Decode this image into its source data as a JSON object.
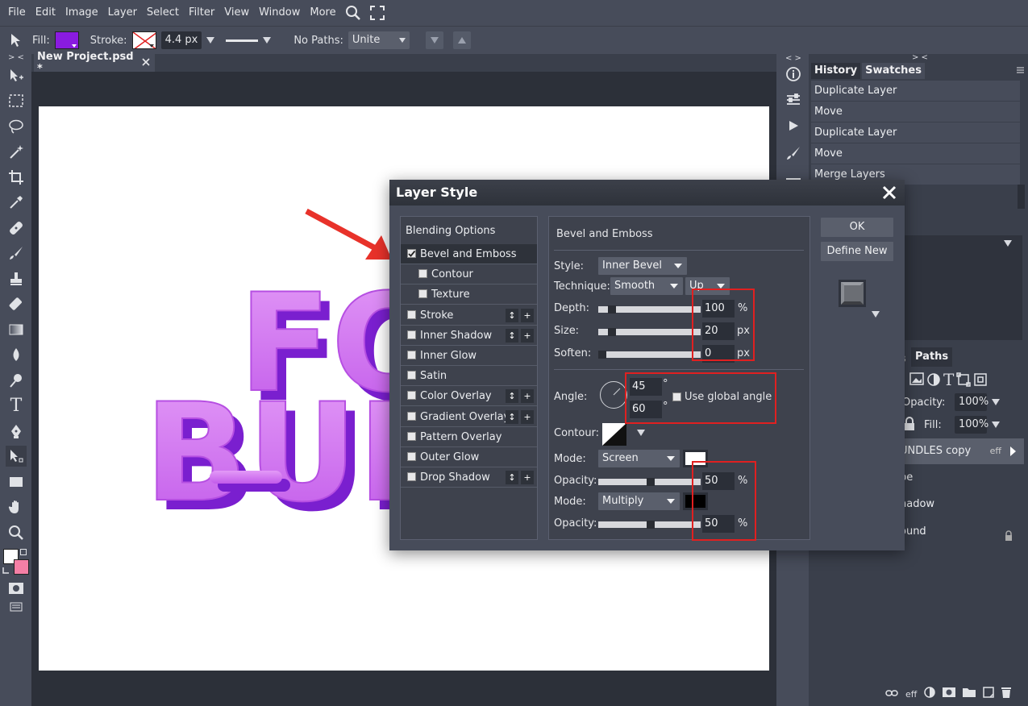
{
  "menubar": {
    "items": [
      "File",
      "Edit",
      "Image",
      "Layer",
      "Select",
      "Filter",
      "View",
      "Window",
      "More"
    ]
  },
  "options": {
    "fill_label": "Fill:",
    "fill_color": "#8a1be0",
    "stroke_label": "Stroke:",
    "stroke_width": "4.4 px",
    "paths_label": "No Paths:",
    "paths_mode": "Unite"
  },
  "document": {
    "tab_title": "New Project.psd *",
    "text_line1": "FO",
    "text_line2": "BUN"
  },
  "history": {
    "tabs": [
      "History",
      "Swatches"
    ],
    "items": [
      "Duplicate Layer",
      "Move",
      "Duplicate Layer",
      "Move",
      "Merge Layers"
    ]
  },
  "layers": {
    "tab_paths": "Paths",
    "opacity_label": "Opacity:",
    "opacity_value": "100%",
    "fill_label": "Fill:",
    "fill_value": "100%",
    "rows": [
      "UNDLES copy",
      "pe",
      "hadow",
      "ound"
    ],
    "eff_badge": "eff",
    "footer_eff": "eff"
  },
  "dialog": {
    "title": "Layer Style",
    "categories": [
      {
        "label": "Blending Options"
      },
      {
        "label": "Bevel and Emboss",
        "checked": true
      },
      {
        "label": "Contour"
      },
      {
        "label": "Texture"
      },
      {
        "label": "Stroke"
      },
      {
        "label": "Inner Shadow"
      },
      {
        "label": "Inner Glow"
      },
      {
        "label": "Satin"
      },
      {
        "label": "Color Overlay"
      },
      {
        "label": "Gradient Overlay"
      },
      {
        "label": "Pattern Overlay"
      },
      {
        "label": "Outer Glow"
      },
      {
        "label": "Drop Shadow"
      }
    ],
    "section_title": "Bevel and Emboss",
    "style_label": "Style:",
    "style_value": "Inner Bevel",
    "technique_label": "Technique:",
    "technique_value": "Smooth",
    "direction_value": "Up",
    "depth_label": "Depth:",
    "depth_value": "100",
    "depth_unit": "%",
    "size_label": "Size:",
    "size_value": "20",
    "size_unit": "px",
    "soften_label": "Soften:",
    "soften_value": "0",
    "soften_unit": "px",
    "angle_label": "Angle:",
    "angle_value": "45",
    "altitude_value": "60",
    "degree_symbol": "°",
    "global_angle_label": "Use global angle",
    "contour_label": "Contour:",
    "mode_label": "Mode:",
    "highlight_mode": "Screen",
    "highlight_color": "#ffffff",
    "opacity_label": "Opacity:",
    "highlight_opacity": "50",
    "shadow_mode": "Multiply",
    "shadow_color": "#000000",
    "shadow_opacity": "50",
    "percent": "%",
    "ok_label": "OK",
    "define_new_label": "Define New"
  }
}
